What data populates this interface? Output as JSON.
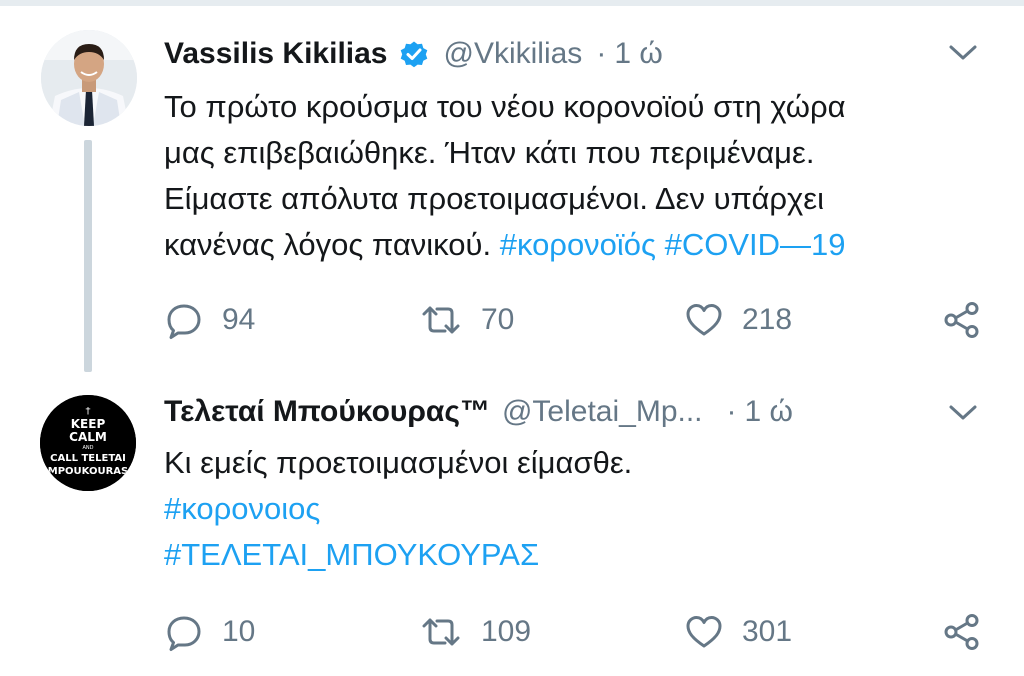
{
  "colors": {
    "link": "#1da1f2",
    "secondary": "#657786",
    "divider": "#ccd6dd"
  },
  "tweets": [
    {
      "name": "Vassilis Kikilias",
      "verified": true,
      "handle": "@Vkikilias",
      "dot": "·",
      "time": "1 ώ",
      "text_lines": [
        "Το πρώτο κρούσμα του νέου κορονοϊού στη χώρα",
        "μας επιβεβαιώθηκε. Ήταν κάτι που περιμέναμε.",
        "Είμαστε απόλυτα προετοιμασμένοι. Δεν υπάρχει"
      ],
      "last_line_text": "κανένας λόγος πανικού. ",
      "hashtags": [
        "#κορονοϊός",
        "#COVID—19"
      ],
      "counts": {
        "replies": "94",
        "retweets": "70",
        "likes": "218"
      },
      "avatar_icon": "profile-photo-man-in-suit"
    },
    {
      "name": "Τελεταί Μπούκουρας™",
      "verified": false,
      "handle": "@Teletai_Mp...",
      "dot": "·",
      "time": "1 ώ",
      "text": "Κι εμείς προετοιμασμένοι είμασθε.",
      "hashtags": [
        "#κορονοιος",
        "#ΤΕΛΕΤΑΙ_ΜΠΟΥΚΟΥΡΑΣ"
      ],
      "counts": {
        "replies": "10",
        "retweets": "109",
        "likes": "301"
      },
      "avatar": {
        "cross": "†",
        "line1": "KEEP",
        "line2": "CALM",
        "line3": "AND",
        "line4": "CALL TELETAI",
        "line5": "ΜPOUKOURAS"
      }
    }
  ]
}
